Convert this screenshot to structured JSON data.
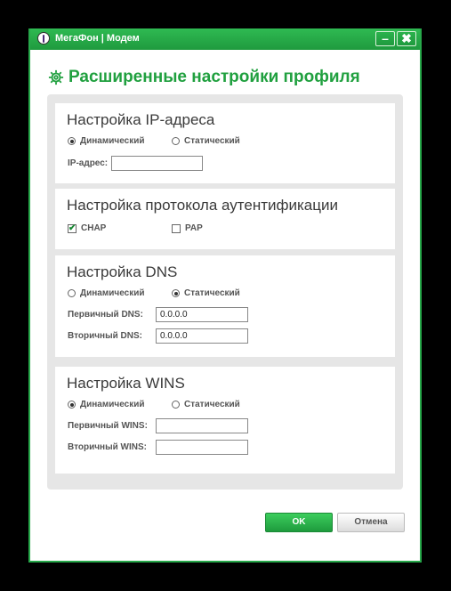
{
  "window": {
    "title": "МегаФон | Модем",
    "minimize_glyph": "–",
    "close_glyph": "✖"
  },
  "page_title": "Расширенные настройки профиля",
  "ip_section": {
    "title": "Настройка IP-адреса",
    "options": [
      {
        "label": "Динамический",
        "selected": true
      },
      {
        "label": "Статический",
        "selected": false
      }
    ],
    "ip_label": "IP-адрес:",
    "ip_value": ""
  },
  "auth_section": {
    "title": "Настройка протокола аутентификации",
    "options": [
      {
        "label": "CHAP",
        "checked": true,
        "check_glyph": "✔"
      },
      {
        "label": "PAP",
        "checked": false,
        "check_glyph": ""
      }
    ]
  },
  "dns_section": {
    "title": "Настройка DNS",
    "options": [
      {
        "label": "Динамический",
        "selected": false
      },
      {
        "label": "Статический",
        "selected": true
      }
    ],
    "primary_label": "Первичный DNS:",
    "primary_value": "0.0.0.0",
    "secondary_label": "Вторичный DNS:",
    "secondary_value": "0.0.0.0"
  },
  "wins_section": {
    "title": "Настройка WINS",
    "options": [
      {
        "label": "Динамический",
        "selected": true
      },
      {
        "label": "Статический",
        "selected": false
      }
    ],
    "primary_label": "Первичный WINS:",
    "primary_value": "",
    "secondary_label": "Вторичный WINS:",
    "secondary_value": ""
  },
  "buttons": {
    "ok": "OK",
    "cancel": "Отмена"
  },
  "colors": {
    "accent": "#20a03f",
    "frame": "#27a84a",
    "panel": "#e6e6e6"
  }
}
